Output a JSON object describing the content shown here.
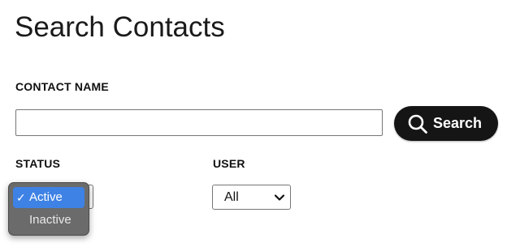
{
  "page": {
    "title": "Search Contacts"
  },
  "contact_name": {
    "label": "CONTACT NAME",
    "value": "",
    "placeholder": ""
  },
  "search_button": {
    "label": "Search",
    "icon": "search-icon"
  },
  "status": {
    "label": "STATUS",
    "selected": "Active",
    "options": [
      {
        "label": "Active",
        "checked": true
      },
      {
        "label": "Inactive",
        "checked": false
      }
    ],
    "check_mark": "✓"
  },
  "user": {
    "label": "USER",
    "selected": "All",
    "icon": "chevron-down-icon"
  },
  "colors": {
    "button_bg": "#151515",
    "highlight": "#3e82e5",
    "popup_bg": "#6b6b6b"
  }
}
